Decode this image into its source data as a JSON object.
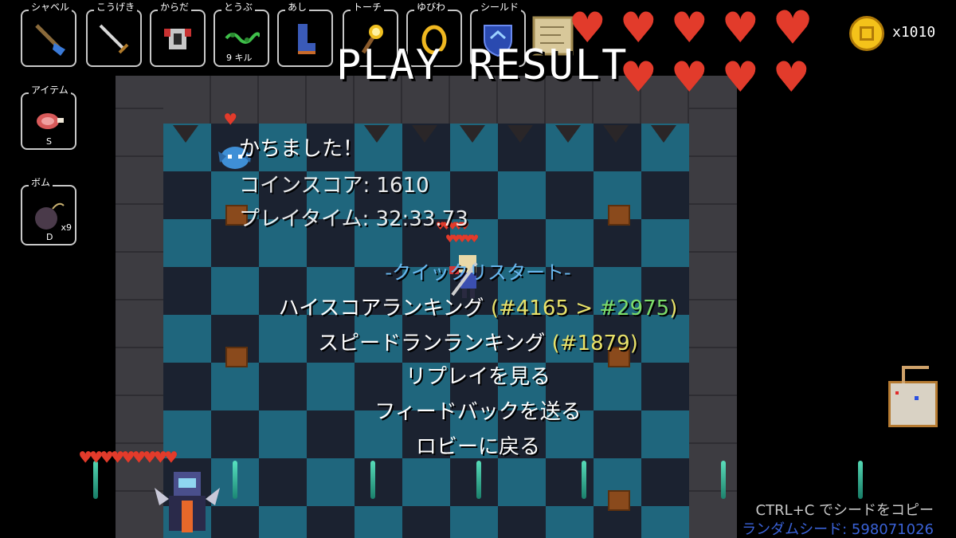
{
  "hud": {
    "slots": [
      {
        "label": "シャベル",
        "sub": ""
      },
      {
        "label": "こうげき",
        "sub": ""
      },
      {
        "label": "からだ",
        "sub": ""
      },
      {
        "label": "とうぶ",
        "sub": "9 キル"
      },
      {
        "label": "あし",
        "sub": ""
      },
      {
        "label": "トーチ",
        "sub": ""
      },
      {
        "label": "ゆびわ",
        "sub": ""
      },
      {
        "label": "シールド",
        "sub": ""
      }
    ],
    "item": {
      "label": "アイテム",
      "key": "S"
    },
    "bomb": {
      "label": "ボム",
      "key": "D",
      "count": "x9"
    },
    "gold_count": "x1010",
    "health": {
      "full_hearts": 9
    }
  },
  "result": {
    "title": "PLAY RESULT",
    "status": "かちました！",
    "coin_score": "コインスコア: 1610",
    "play_time": "プレイタイム: 32:33.73"
  },
  "menu": {
    "quick_restart": "-クイックリスタート-",
    "highscore_label": "ハイスコアランキング",
    "highscore_prefix": " (#4165 > ",
    "highscore_new": "#2975",
    "highscore_suffix": ")",
    "speedrun_label": "スピードランランキング",
    "speedrun_rank": " (#1879)",
    "replay": "リプレイを見る",
    "feedback": "フィードバックを送る",
    "lobby": "ロビーに戻る"
  },
  "footer": {
    "copy_hint": "CTRL+C でシードをコピー",
    "random_seed": "ランダムシード: 598071026"
  },
  "colors": {
    "heart": "#e23b2b",
    "gold": "#f4c21a",
    "rank_yellow": "#e8e26a",
    "rank_green": "#7cdc6a",
    "quick_restart": "#6ab8f0",
    "seed": "#3a62d8"
  }
}
